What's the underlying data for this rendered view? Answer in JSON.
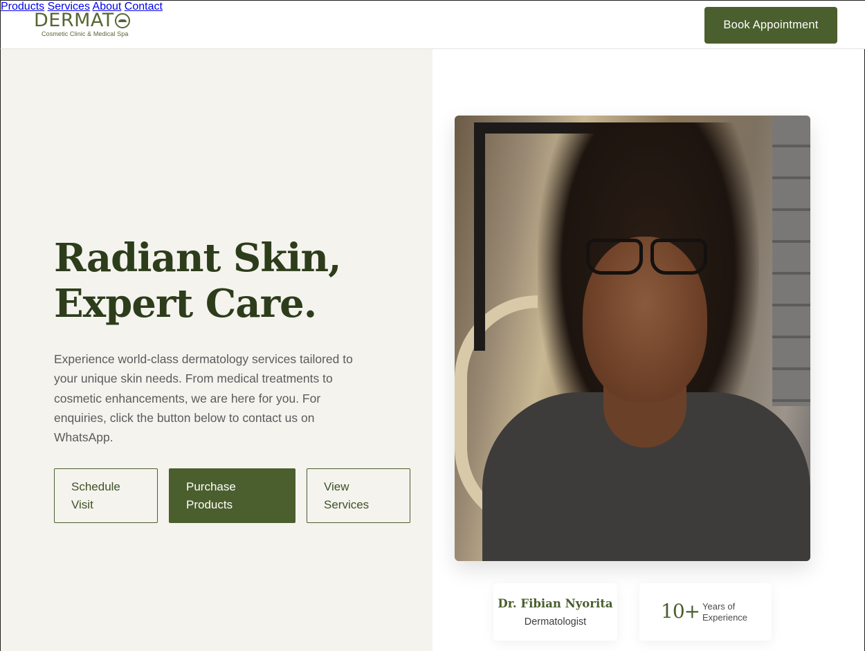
{
  "brand": {
    "name": "DERMATO",
    "name_prefix": "DERMAT",
    "tagline": "Cosmetic Clinic & Medical Spa"
  },
  "nav": {
    "items": [
      "Products",
      "Services",
      "About",
      "Contact"
    ],
    "book_label": "Book Appointment"
  },
  "hero": {
    "headline_line1": "Radiant Skin,",
    "headline_line2": "Expert Care.",
    "intro": "Experience world-class dermatology services tailored to your unique skin needs. From medical treatments to cosmetic enhancements, we are here for you. For enquiries, click the button below to contact us on WhatsApp.",
    "buttons": {
      "schedule": "Schedule Visit",
      "purchase": "Purchase Products",
      "services": "View Services"
    }
  },
  "doctor": {
    "name": "Dr. Fibian Nyorita",
    "role": "Dermatologist"
  },
  "experience": {
    "number": "10+",
    "label_line1": "Years of",
    "label_line2": "Experience"
  },
  "colors": {
    "brand_green": "#4b5e2d",
    "headline_green": "#2d3d1b",
    "hero_bg": "#f4f3ee"
  }
}
